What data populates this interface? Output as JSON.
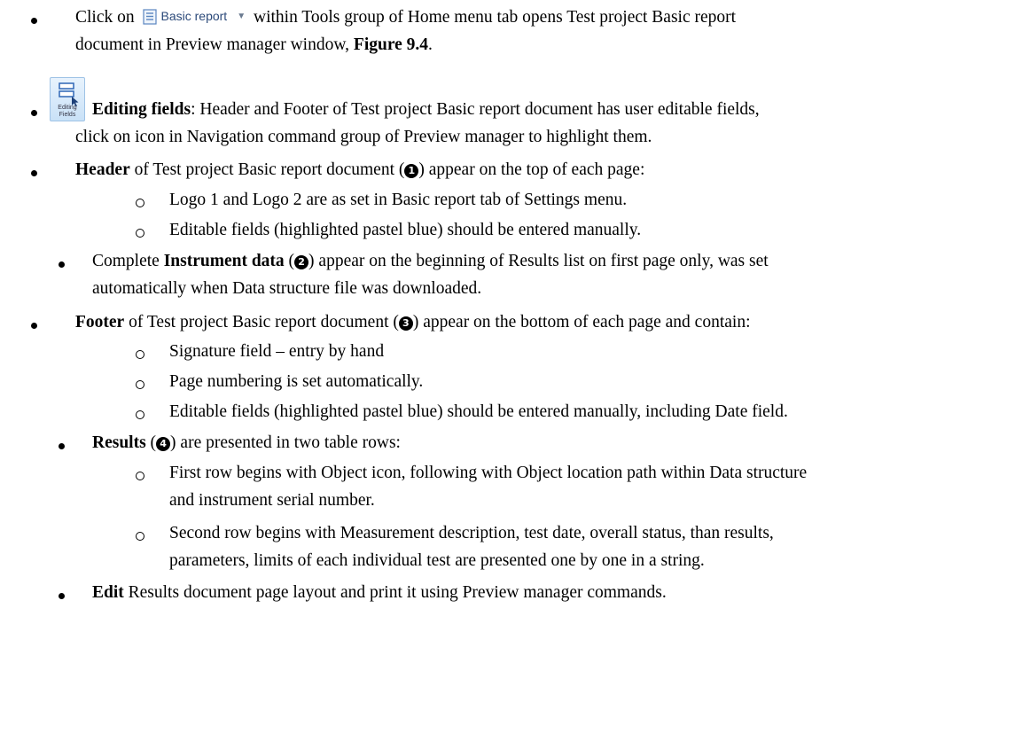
{
  "items": {
    "i1": {
      "pre": "Click on",
      "button_label": "Basic report",
      "post": "within Tools group of Home menu tab opens Test project Basic report",
      "line2a": "document in Preview manager window, ",
      "fig": "Figure 9.4",
      "line2b": "."
    },
    "i2": {
      "icon_caption_1": "Editing",
      "icon_caption_2": "Fields",
      "bold": "Editing fields",
      "rest": ": Header and Footer of Test project Basic report document has user editable fields,",
      "line2": "click on icon in Navigation command group of Preview manager to highlight them."
    },
    "i3": {
      "bold": "Header",
      "rest_a": " of Test project Basic report document (",
      "num": "1",
      "rest_b": ") appear on the top of each page:",
      "sub1": "Logo 1 and Logo 2 are as set in Basic report tab of Settings menu.",
      "sub2": "Editable fields (highlighted pastel blue) should be entered manually."
    },
    "i4": {
      "pre": "Complete ",
      "bold": "Instrument data",
      "rest_a": " (",
      "num": "2",
      "rest_b": ") appear on the beginning of Results list on first page only, was set",
      "line2": "automatically when Data structure file was downloaded."
    },
    "i5": {
      "bold": "Footer",
      "rest_a": " of Test project Basic report document (",
      "num": "3",
      "rest_b": ") appear on the bottom of each page and contain:",
      "sub1": "Signature field – entry by hand",
      "sub2": "Page numbering is set automatically.",
      "sub3": "Editable fields (highlighted pastel blue) should be entered manually, including Date field."
    },
    "i6": {
      "bold": "Results",
      "rest_a": " (",
      "num": "4",
      "rest_b": ") are presented in two table rows:",
      "sub1_l1": "First row begins with Object icon, following with Object location path within Data structure",
      "sub1_l2": "and instrument serial number.",
      "sub2_l1": "Second row begins with Measurement description, test date, overall status, than results,",
      "sub2_l2": "parameters, limits of each individual test are presented one by one in a string."
    },
    "i7": {
      "bold": "Edit",
      "rest": " Results document page layout and print it using Preview manager commands."
    }
  }
}
